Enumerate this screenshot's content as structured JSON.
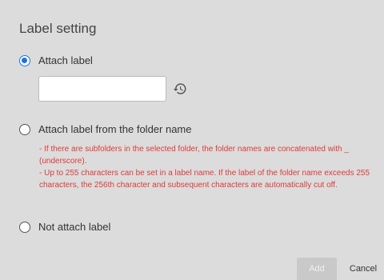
{
  "dialog": {
    "title": "Label setting"
  },
  "options": [
    {
      "label": "Attach label",
      "selected": true
    },
    {
      "label": "Attach label from the folder name",
      "selected": false
    },
    {
      "label": "Not attach label",
      "selected": false
    }
  ],
  "label_input": {
    "value": "",
    "placeholder": ""
  },
  "notes": [
    "- If there are subfolders in the selected folder, the folder names are concatenated with _ (underscore).",
    "- Up to 255 characters can be set in a label name. If the label of the folder name exceeds 255 characters, the 256th character and subsequent characters are automatically cut off."
  ],
  "buttons": {
    "add": "Add",
    "cancel": "Cancel"
  },
  "colors": {
    "accent": "#1a73e8",
    "note_text": "#e03a3a",
    "background": "#dcdcdc"
  },
  "icons": {
    "history": "history-icon"
  }
}
